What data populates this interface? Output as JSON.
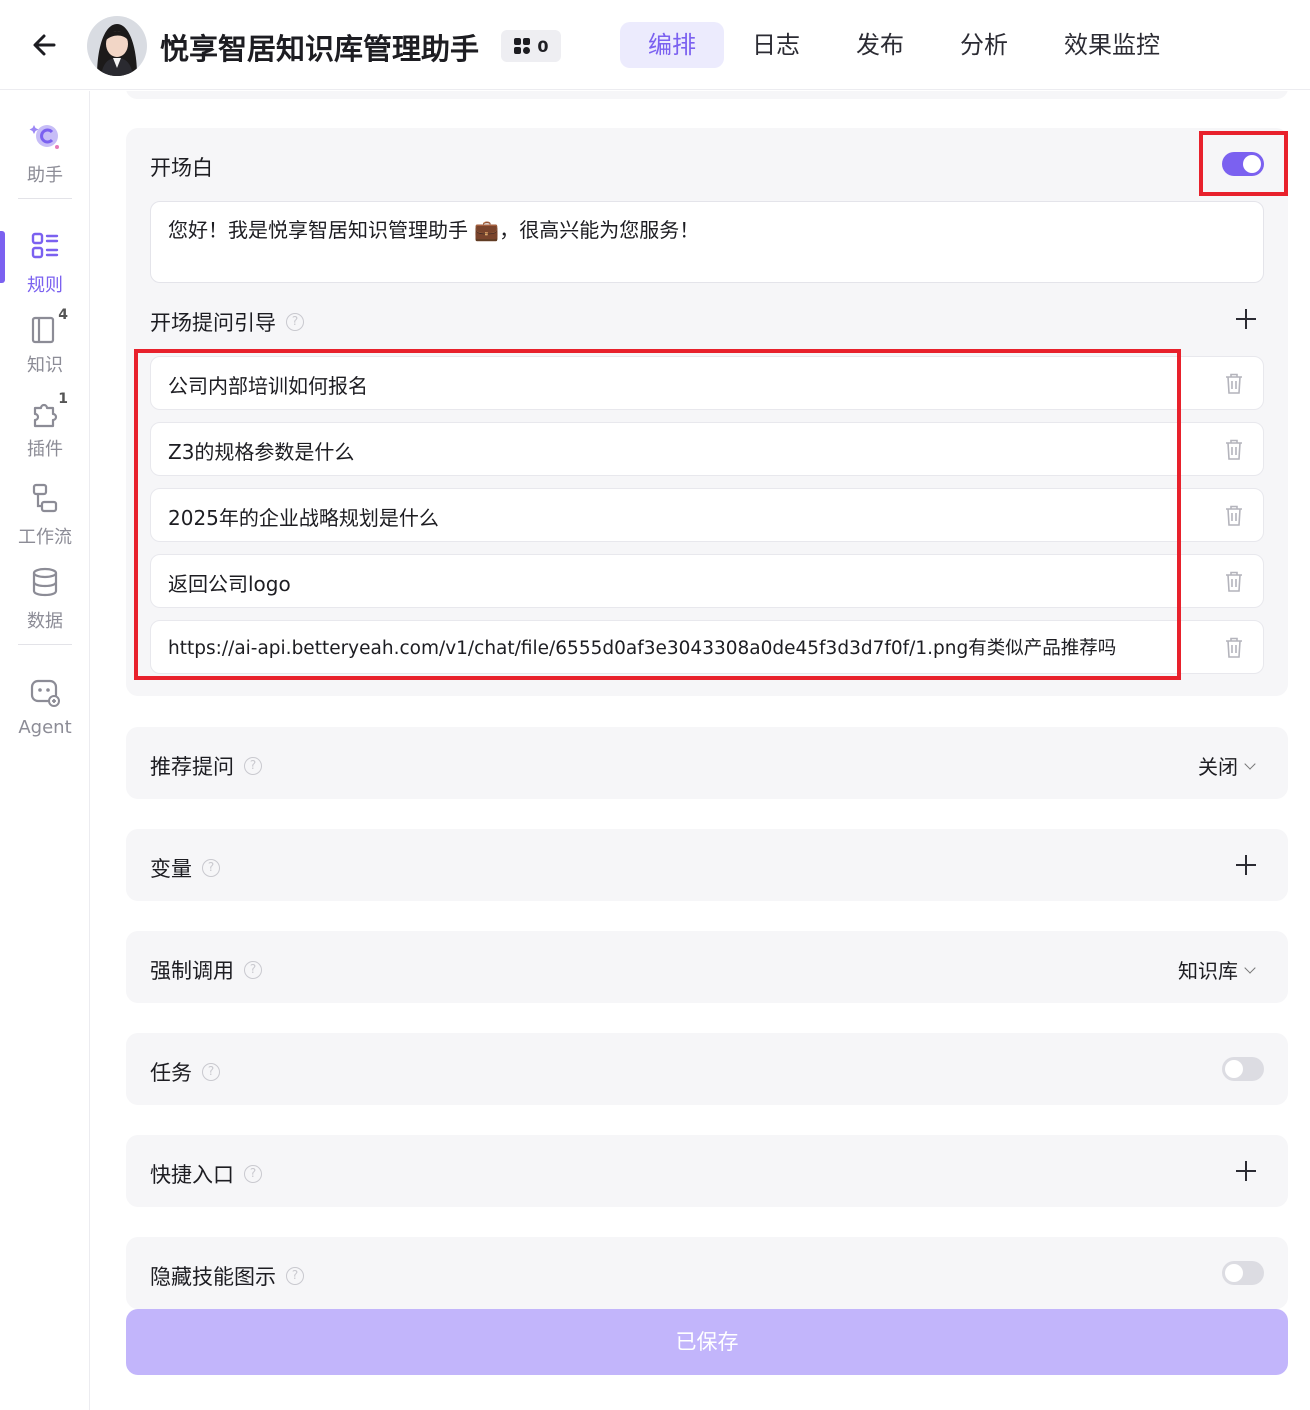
{
  "header": {
    "title": "悦享智居知识库管理助手",
    "badge_count": "0",
    "tabs": [
      {
        "label": "编排",
        "active": true
      },
      {
        "label": "日志",
        "active": false
      },
      {
        "label": "发布",
        "active": false
      },
      {
        "label": "分析",
        "active": false
      },
      {
        "label": "效果监控",
        "active": false
      }
    ]
  },
  "sidebar": {
    "items": [
      {
        "label": "助手",
        "icon": "assistant-icon"
      },
      {
        "label": "规则",
        "icon": "rules-icon",
        "active": true
      },
      {
        "label": "知识",
        "icon": "knowledge-icon",
        "count": "4"
      },
      {
        "label": "插件",
        "icon": "plugin-icon",
        "count": "1"
      },
      {
        "label": "工作流",
        "icon": "workflow-icon"
      },
      {
        "label": "数据",
        "icon": "database-icon"
      },
      {
        "label": "Agent",
        "icon": "agent-icon"
      }
    ]
  },
  "opening": {
    "title": "开场白",
    "enabled": true,
    "greeting": "您好！我是悦享智居知识管理助手 💼，很高兴能为您服务！",
    "guide_title": "开场提问引导",
    "questions": [
      "公司内部培训如何报名",
      "Z3的规格参数是什么",
      "2025年的企业战略规划是什么",
      "返回公司logo",
      "https://ai-api.betteryeah.com/v1/chat/file/6555d0af3e3043308a0de45f3d3d7f0f/1.png有类似产品推荐吗"
    ]
  },
  "sections": {
    "recommend": {
      "title": "推荐提问",
      "value": "关闭"
    },
    "variables": {
      "title": "变量"
    },
    "force_call": {
      "title": "强制调用",
      "value": "知识库"
    },
    "task": {
      "title": "任务",
      "enabled": false
    },
    "shortcut": {
      "title": "快捷入口"
    },
    "hide_skill": {
      "title": "隐藏技能图示",
      "enabled": false
    }
  },
  "help_glyph": "?",
  "save_button": "已保存",
  "colors": {
    "accent": "#7b61f0",
    "accent_light": "#ecebfd",
    "save_disabled": "#c2b5fb",
    "highlight_red": "#e8212c",
    "card_bg": "#f6f6f8"
  }
}
